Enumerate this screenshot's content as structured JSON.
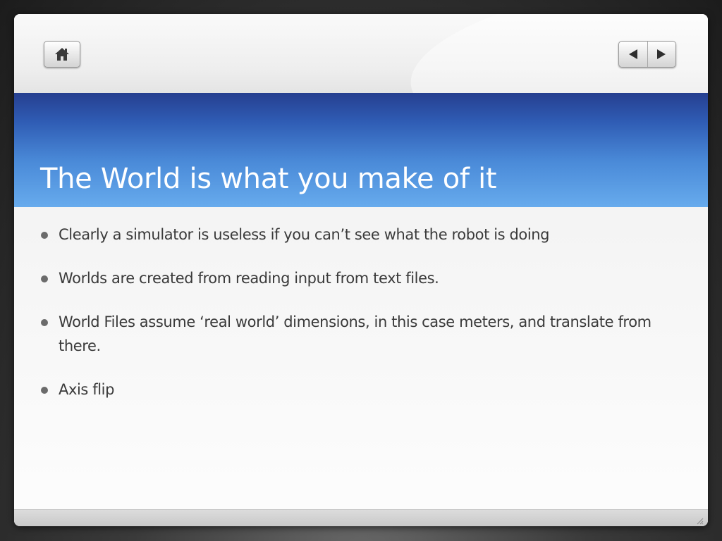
{
  "slide": {
    "title": "The World is what you make of it",
    "bullets": [
      "Clearly a simulator is useless if you can’t see what the robot is doing",
      "Worlds are created from reading input from text files.",
      "World Files assume ‘real world’ dimensions, in this case meters, and translate from there.",
      "Axis flip"
    ]
  },
  "navigation": {
    "home_icon": "home-icon",
    "previous_icon": "triangle-left-icon",
    "next_icon": "triangle-right-icon"
  },
  "colors": {
    "title_band_top": "#263f90",
    "title_band_bottom": "#67abed",
    "title_text": "#ffffff",
    "bullet_text": "#3a3a3a",
    "bullet_dot": "#6b6b6b"
  }
}
